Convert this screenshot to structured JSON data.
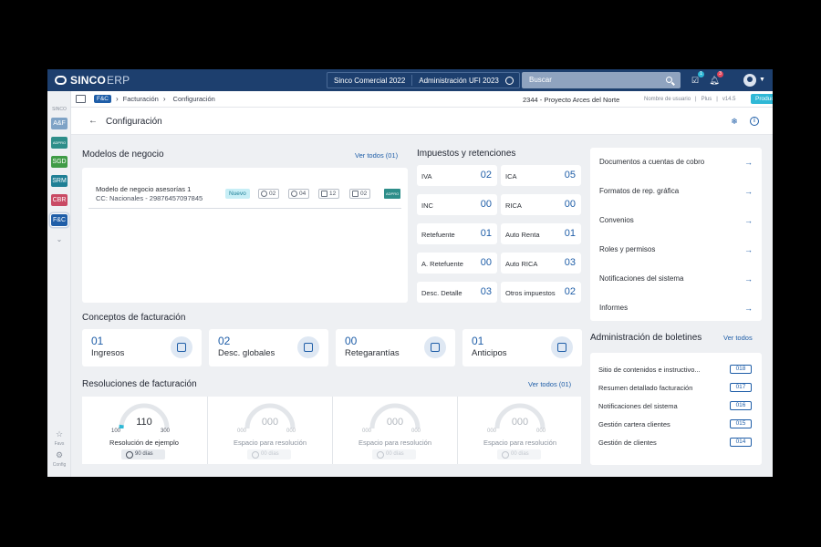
{
  "app": {
    "logo_main": "SINCO",
    "logo_sub": "ERP"
  },
  "topbar": {
    "company": "Sinco Comercial 2022",
    "admin": "Administración UFI 2023",
    "search_placeholder": "Buscar",
    "tasks_badge": "1",
    "notif_badge": "3"
  },
  "rail": {
    "header": "SINCO",
    "modules": [
      {
        "label": "A&F",
        "color": "#7fa3c6"
      },
      {
        "label": "ADPRO",
        "color": "#2e8e8a"
      },
      {
        "label": "SGD",
        "color": "#3f9b46"
      },
      {
        "label": "SRM",
        "color": "#1f7f95"
      },
      {
        "label": "CBR",
        "color": "#c94a64"
      },
      {
        "label": "F&C",
        "color": "#1f5ea8"
      }
    ],
    "favs_label": "Favs",
    "config_label": "Config"
  },
  "subheader": {
    "chip": "F&C",
    "crumb1": "Facturación",
    "crumb2": "Configuración",
    "project": "2344 - Proyecto Arces del Norte",
    "username": "Nombre de usuario",
    "plan": "Plus",
    "version": "v14.5",
    "env": "Producción"
  },
  "page": {
    "title": "Configuración"
  },
  "modelos": {
    "title": "Modelos de negocio",
    "view_all": "Ver todos (01)",
    "item": {
      "name": "Modelo de negocio asesorías 1",
      "cc": "CC: Nacionales - 29876457097845",
      "status": "Nuevo",
      "counts": [
        "02",
        "04",
        "12",
        "02"
      ],
      "tag": "ADPRO"
    }
  },
  "impuestos": {
    "title": "Impuestos y retenciones",
    "items": [
      {
        "label": "IVA",
        "value": "02"
      },
      {
        "label": "ICA",
        "value": "05"
      },
      {
        "label": "INC",
        "value": "00"
      },
      {
        "label": "RICA",
        "value": "00"
      },
      {
        "label": "Retefuente",
        "value": "01"
      },
      {
        "label": "Auto Renta",
        "value": "01"
      },
      {
        "label": "A. Retefuente",
        "value": "00"
      },
      {
        "label": "Auto RICA",
        "value": "03"
      },
      {
        "label": "Desc. Detalle",
        "value": "03"
      },
      {
        "label": "Otros impuestos",
        "value": "02"
      }
    ]
  },
  "menu": {
    "items": [
      "Documentos a cuentas de cobro",
      "Formatos de rep. gráfica",
      "Convenios",
      "Roles y permisos",
      "Notificaciones del sistema",
      "Informes"
    ]
  },
  "conceptos": {
    "title": "Conceptos de facturación",
    "items": [
      {
        "count": "01",
        "label": "Ingresos",
        "icon": "coin-icon"
      },
      {
        "count": "02",
        "label": "Desc. globales",
        "icon": "tag-icon"
      },
      {
        "count": "00",
        "label": "Retegarantías",
        "icon": "clipboard-icon"
      },
      {
        "count": "01",
        "label": "Anticipos",
        "icon": "box-icon"
      }
    ]
  },
  "resoluciones": {
    "title": "Resoluciones de facturación",
    "view_all": "Ver todos (01)",
    "items": [
      {
        "value": "110",
        "min": "100",
        "max": "300",
        "name": "Resolución de ejemplo",
        "days": "90 días",
        "progress": 0.05
      },
      {
        "value": "000",
        "min": "000",
        "max": "000",
        "name": "Espacio para resolución",
        "days": "00 días",
        "progress": 0
      },
      {
        "value": "000",
        "min": "000",
        "max": "000",
        "name": "Espacio para resolución",
        "days": "00 días",
        "progress": 0
      },
      {
        "value": "000",
        "min": "000",
        "max": "000",
        "name": "Espacio para resolución",
        "days": "00 días",
        "progress": 0
      }
    ]
  },
  "boletines": {
    "title": "Administración de boletines",
    "view_all": "Ver todos",
    "items": [
      {
        "label": "Sitio de contenidos e instructivo...",
        "num": "018"
      },
      {
        "label": "Resumen detallado facturación",
        "num": "017"
      },
      {
        "label": "Notificaciones del sistema",
        "num": "016"
      },
      {
        "label": "Gestión cartera clientes",
        "num": "015"
      },
      {
        "label": "Gestión de clientes",
        "num": "014"
      }
    ]
  },
  "colors": {
    "primary": "#1f5ea8",
    "navy": "#1d3f6e",
    "accent": "#2fb8d6"
  }
}
